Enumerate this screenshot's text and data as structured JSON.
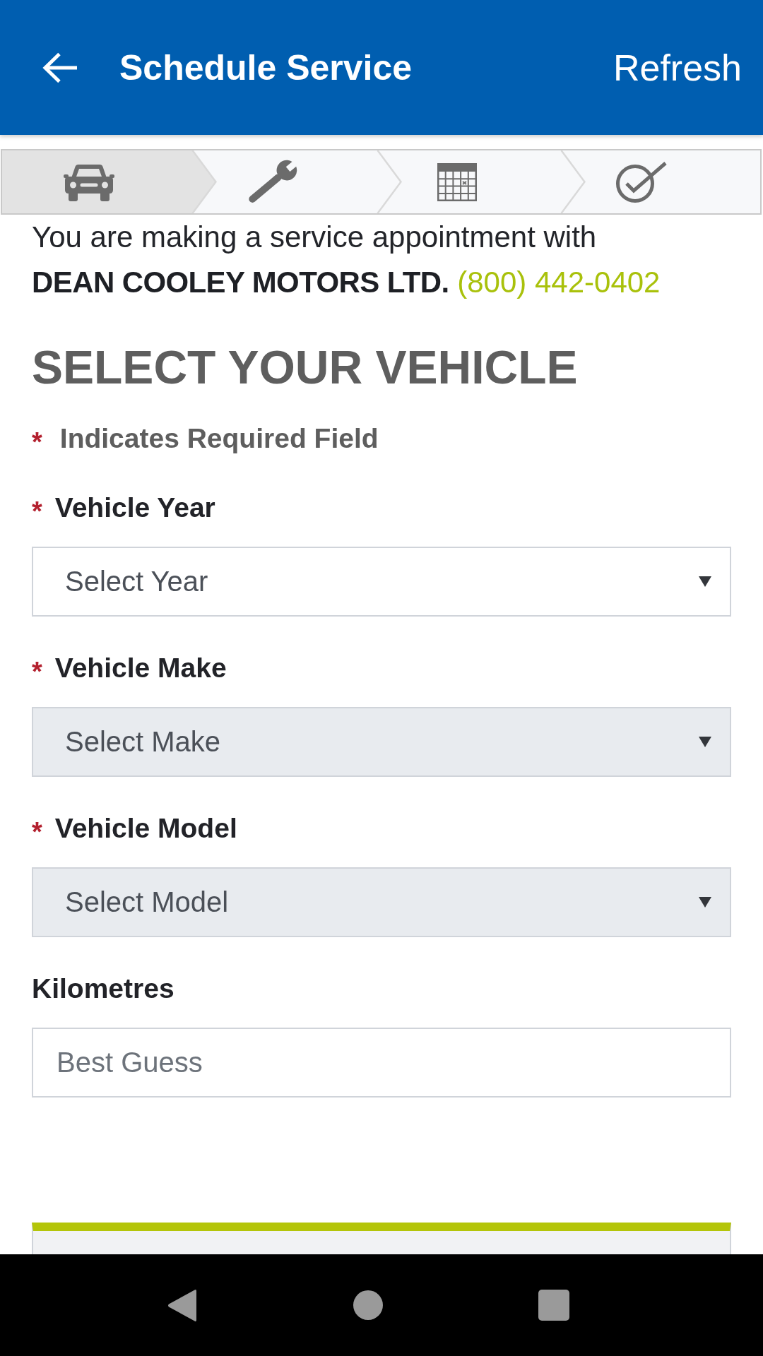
{
  "app_bar": {
    "title": "Schedule Service",
    "action": "Refresh"
  },
  "steps": [
    {
      "selected": true
    },
    {
      "selected": false
    },
    {
      "selected": false
    },
    {
      "selected": false
    }
  ],
  "intro": {
    "text": "You are making a service appointment with **DEAN COOLEY MOTORS LTD.**",
    "phone": "(800) 442-0402"
  },
  "heading": "SELECT YOUR VEHICLE",
  "required_note": {
    "mark": "*",
    "text": "Indicates Required Field"
  },
  "fields": [
    {
      "kind": "select",
      "required_mark": "*",
      "label": "Vehicle Year",
      "value": "Select Year",
      "disabled": false
    },
    {
      "kind": "select",
      "required_mark": "*",
      "label": "Vehicle Make",
      "value": "Select Make",
      "disabled": true
    },
    {
      "kind": "select",
      "required_mark": "*",
      "label": "Vehicle Model",
      "value": "Select Model",
      "disabled": true
    },
    {
      "kind": "text",
      "label": "Kilometres",
      "placeholder": "Best Guess"
    }
  ]
}
